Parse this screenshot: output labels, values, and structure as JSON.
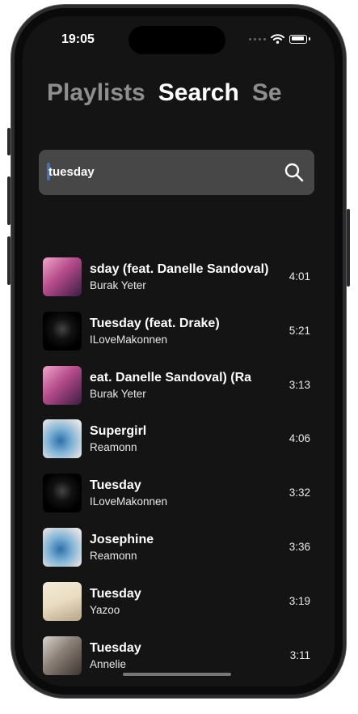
{
  "status_bar": {
    "time": "19:05"
  },
  "tabs": [
    {
      "label": "Playlists",
      "active": false
    },
    {
      "label": "Search",
      "active": true
    },
    {
      "label": "Se",
      "active": false
    }
  ],
  "search": {
    "value": "tuesday",
    "icon": "magnifier-icon"
  },
  "results": [
    {
      "title": "sday (feat. Danelle Sandoval)",
      "artist": "Burak Yeter",
      "duration": "4:01",
      "art": "pink"
    },
    {
      "title": "Tuesday (feat. Drake)",
      "artist": "ILoveMakonnen",
      "duration": "5:21",
      "art": "black"
    },
    {
      "title": "eat. Danelle Sandoval) (Ra",
      "artist": "Burak Yeter",
      "duration": "3:13",
      "art": "pink"
    },
    {
      "title": "Supergirl",
      "artist": "Reamonn",
      "duration": "4:06",
      "art": "blue"
    },
    {
      "title": "Tuesday",
      "artist": "ILoveMakonnen",
      "duration": "3:32",
      "art": "black"
    },
    {
      "title": "Josephine",
      "artist": "Reamonn",
      "duration": "3:36",
      "art": "blue"
    },
    {
      "title": "Tuesday",
      "artist": "Yazoo",
      "duration": "3:19",
      "art": "cream"
    },
    {
      "title": "Tuesday",
      "artist": "Annelie",
      "duration": "3:11",
      "art": "portrait"
    }
  ],
  "colors": {
    "background": "#151414",
    "search_field": "#474748",
    "inactive_tab": "#8e8e8e",
    "text": "#ffffff"
  }
}
